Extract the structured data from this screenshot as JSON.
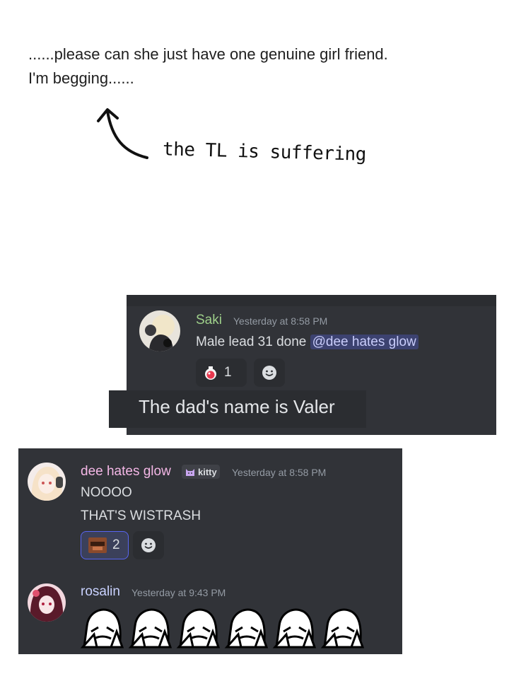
{
  "note": {
    "line1": "......please can she just have one genuine girl friend.",
    "line2": "I'm begging......",
    "handwritten": "the TL is suffering"
  },
  "panel1": {
    "username": "Saki",
    "username_color": "#9ecf8a",
    "timestamp": "Yesterday at 8:58 PM",
    "message_prefix": "Male lead 31 done ",
    "mention": "@dee hates glow",
    "reaction_count": "1",
    "caption": "The dad's name is Valer"
  },
  "panel2": {
    "messages": [
      {
        "username": "dee hates glow",
        "username_color": "#f4b7e6",
        "tag": "kitty",
        "timestamp": "Yesterday at 8:58 PM",
        "lines": [
          "NOOOO",
          "THAT'S WISTRASH"
        ],
        "reaction_count": "2"
      },
      {
        "username": "rosalin",
        "username_color": "#c9d2ff",
        "timestamp": "Yesterday at 9:43 PM",
        "stickers": 6
      }
    ]
  },
  "colors": {
    "bg": "#313338",
    "secondary": "#2b2d31",
    "text": "#dbdee1",
    "muted": "#949ba4",
    "mention_bg": "#3c4270",
    "reaction_active_border": "#5865f2"
  }
}
